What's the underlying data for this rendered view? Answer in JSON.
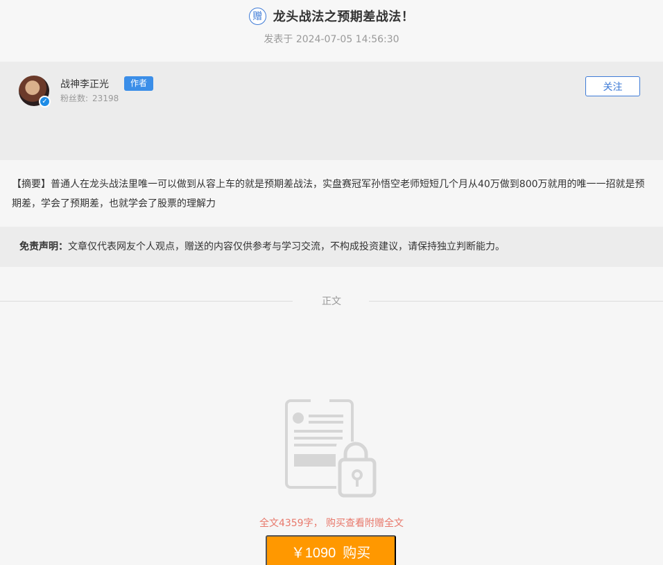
{
  "header": {
    "badge": "赠",
    "title": "龙头战法之预期差战法！",
    "published": "发表于 2024-07-05 14:56:30"
  },
  "author": {
    "name": "战神李正光",
    "tag": "作者",
    "fans_label": "粉丝数:",
    "fans_count": "23198",
    "verified_mark": "✓",
    "follow_label": "关注"
  },
  "summary": {
    "text": "【摘要】普通人在龙头战法里唯一可以做到从容上车的就是预期差战法，实盘赛冠军孙悟空老师短短几个月从40万做到800万就用的唯一一招就是预期差，学会了预期差，也就学会了股票的理解力"
  },
  "disclaimer": {
    "label": "免责声明：",
    "text": "文章仅代表网友个人观点，赠送的内容仅供参考与学习交流，不构成投资建议，请保持独立判断能力。"
  },
  "body": {
    "divider_label": "正文",
    "locked_icon": "locked-document-icon",
    "hint": "全文4359字， 购买查看附赠全文",
    "price": "￥1090",
    "buy_label": "购买"
  },
  "colors": {
    "accent_blue": "#3d7ad6",
    "buy_orange": "#ff9800",
    "hint_red": "#e8786b"
  }
}
